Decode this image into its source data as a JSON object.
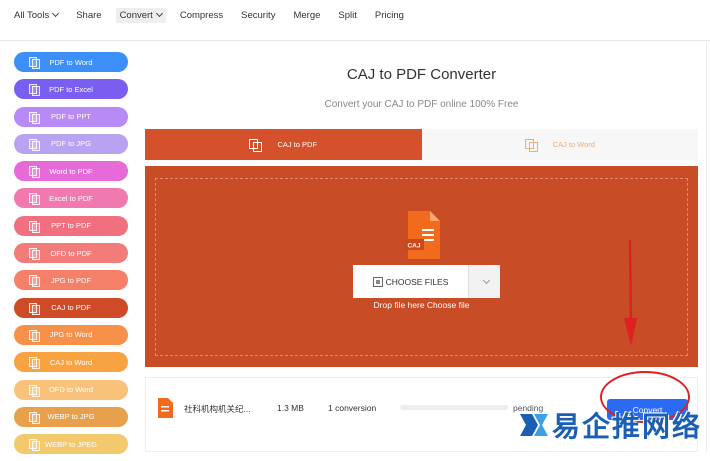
{
  "nav": {
    "items": [
      "All Tools",
      "Share",
      "Convert",
      "Compress",
      "Security",
      "Merge",
      "Split",
      "Pricing"
    ]
  },
  "sidebar": {
    "items": [
      {
        "label": "PDF to Word",
        "color": "#3b8ff6"
      },
      {
        "label": "PDF to Excel",
        "color": "#7a5ef0"
      },
      {
        "label": "PDF to PPT",
        "color": "#b88af5"
      },
      {
        "label": "PDF to JPG",
        "color": "#b8a3f0"
      },
      {
        "label": "Word to PDF",
        "color": "#e66ad8"
      },
      {
        "label": "Excel to PDF",
        "color": "#f07ab0"
      },
      {
        "label": "PPT to PDF",
        "color": "#f07080"
      },
      {
        "label": "OFD to PDF",
        "color": "#f27c7a"
      },
      {
        "label": "JPG to PDF",
        "color": "#f5806a"
      },
      {
        "label": "CAJ to PDF",
        "color": "#cf4a26"
      },
      {
        "label": "JPG to Word",
        "color": "#f79048"
      },
      {
        "label": "CAJ to Word",
        "color": "#f7a342"
      },
      {
        "label": "OFD to Word",
        "color": "#f8c27a"
      },
      {
        "label": "WEBP to JPG",
        "color": "#e8a04c"
      },
      {
        "label": "WEBP to JPEG",
        "color": "#f2c96c"
      }
    ]
  },
  "main": {
    "title": "CAJ to PDF Converter",
    "subtitle": "Convert your CAJ to PDF online 100% Free",
    "tabs": [
      {
        "label": "CAJ to PDF"
      },
      {
        "label": "CAJ to Word"
      }
    ],
    "choose_label": "CHOOSE FILES",
    "drop_text": "Drop file here Choose file",
    "file_icon_label": "CAJ"
  },
  "file": {
    "name": "社科机构机关纪...",
    "size": "1.3 MB",
    "conversion": "1 conversion",
    "progress": 0.0,
    "status": "pending",
    "convert_label": "Convert"
  },
  "watermark": {
    "text": "易企推网络"
  },
  "colors": {
    "accent": "#d4512b",
    "convert_button": "#2b6bf3",
    "annotation": "#e02020"
  }
}
